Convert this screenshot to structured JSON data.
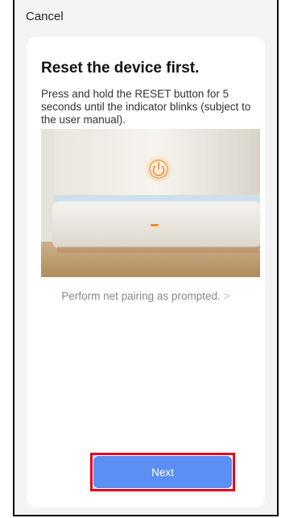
{
  "header": {
    "cancel_label": "Cancel"
  },
  "content": {
    "title": "Reset the device first.",
    "description": "Press and hold the RESET button for 5 seconds until the indicator blinks (subject to the user manual).",
    "image_icon": "power-icon",
    "pairing_link": "Perform net pairing as prompted.",
    "pairing_chevron": ">"
  },
  "footer": {
    "next_label": "Next"
  },
  "colors": {
    "primary_button": "#5b8ff5",
    "highlight": "#e3001b",
    "indicator": "#f08a2a"
  }
}
